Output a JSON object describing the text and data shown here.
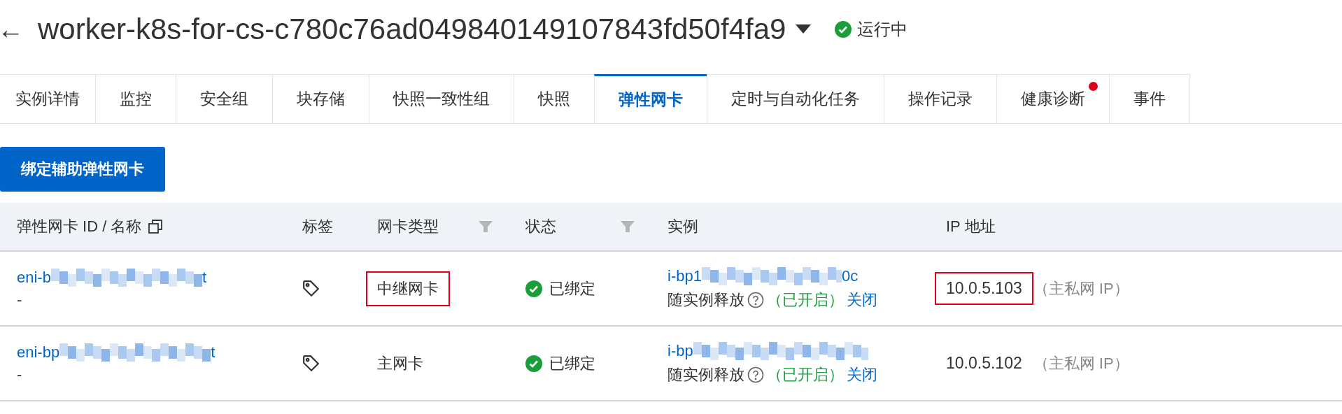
{
  "header": {
    "back": "←",
    "title": "worker-k8s-for-cs-c780c76ad049840149107843fd50f4fa9",
    "status": "运行中"
  },
  "tabs": [
    {
      "label": "实例详情",
      "selected": false,
      "alert": false
    },
    {
      "label": "监控",
      "selected": false,
      "alert": false
    },
    {
      "label": "安全组",
      "selected": false,
      "alert": false
    },
    {
      "label": "块存储",
      "selected": false,
      "alert": false
    },
    {
      "label": "快照一致性组",
      "selected": false,
      "alert": false
    },
    {
      "label": "快照",
      "selected": false,
      "alert": false
    },
    {
      "label": "弹性网卡",
      "selected": true,
      "alert": false
    },
    {
      "label": "定时与自动化任务",
      "selected": false,
      "alert": false
    },
    {
      "label": "操作记录",
      "selected": false,
      "alert": false
    },
    {
      "label": "健康诊断",
      "selected": false,
      "alert": true
    },
    {
      "label": "事件",
      "selected": false,
      "alert": false
    }
  ],
  "primary_button": "绑定辅助弹性网卡",
  "table": {
    "columns": [
      {
        "label": "弹性网卡 ID / 名称",
        "kind": "copy"
      },
      {
        "label": "标签",
        "kind": "plain"
      },
      {
        "label": "网卡类型",
        "kind": "filter"
      },
      {
        "label": "状态",
        "kind": "filter"
      },
      {
        "label": "实例",
        "kind": "plain"
      },
      {
        "label": "IP 地址",
        "kind": "plain"
      }
    ],
    "rows": [
      {
        "id_prefix": "eni-b",
        "id_suffix": "t",
        "name": "-",
        "type": "中继网卡",
        "type_highlighted": true,
        "status": "已绑定",
        "instance_prefix": "i-bp1",
        "instance_suffix": "0c",
        "release_label": "随实例释放",
        "release_state": "（已开启）",
        "release_action": "关闭",
        "ip": "10.0.5.103",
        "ip_highlighted": true,
        "ip_note": "（主私网 IP）"
      },
      {
        "id_prefix": "eni-bp",
        "id_suffix": "t",
        "name": "-",
        "type": "主网卡",
        "type_highlighted": false,
        "status": "已绑定",
        "instance_prefix": "i-bp",
        "instance_suffix": "",
        "release_label": "随实例释放",
        "release_state": "（已开启）",
        "release_action": "关闭",
        "ip": "10.0.5.102",
        "ip_highlighted": false,
        "ip_note": "（主私网 IP）"
      }
    ]
  }
}
